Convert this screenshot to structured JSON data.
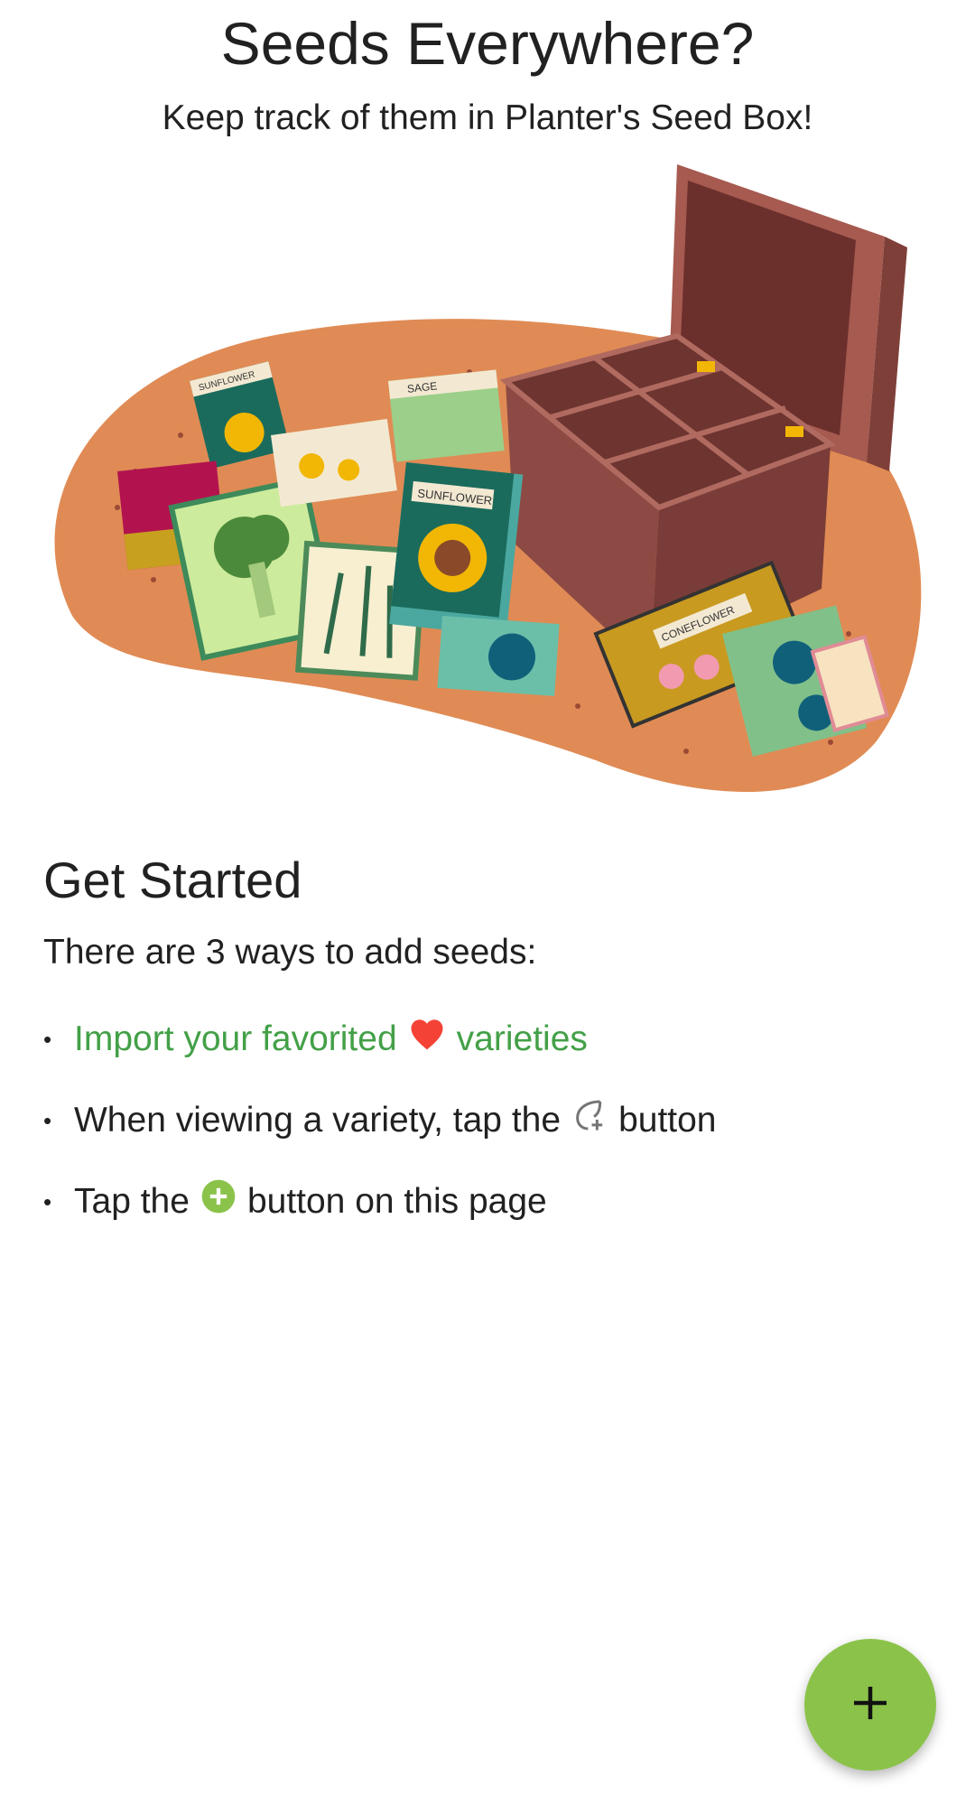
{
  "header": {
    "title": "Seeds Everywhere?",
    "subtitle": "Keep track of them in Planter's Seed Box!"
  },
  "illustration": {
    "packet_labels": [
      "SUNFLOWER",
      "SAGE",
      "SUNFLOWER",
      "CONEFLOWER"
    ]
  },
  "get_started": {
    "title": "Get Started",
    "intro": "There are 3 ways to add seeds:",
    "ways": [
      {
        "before": "Import your favorited",
        "icon": "heart-icon",
        "after": "varieties"
      },
      {
        "before": "When viewing a variety, tap the",
        "icon": "add-seed-leaf-icon",
        "after": "button"
      },
      {
        "before": "Tap the",
        "icon": "add-circle-icon",
        "after": "button on this page"
      }
    ]
  },
  "fab": {
    "icon": "plus-icon"
  },
  "colors": {
    "link": "#43a047",
    "fab": "#8bc34a",
    "heart": "#f44336",
    "mat": "#e08b55",
    "box": "#8d4a45"
  }
}
